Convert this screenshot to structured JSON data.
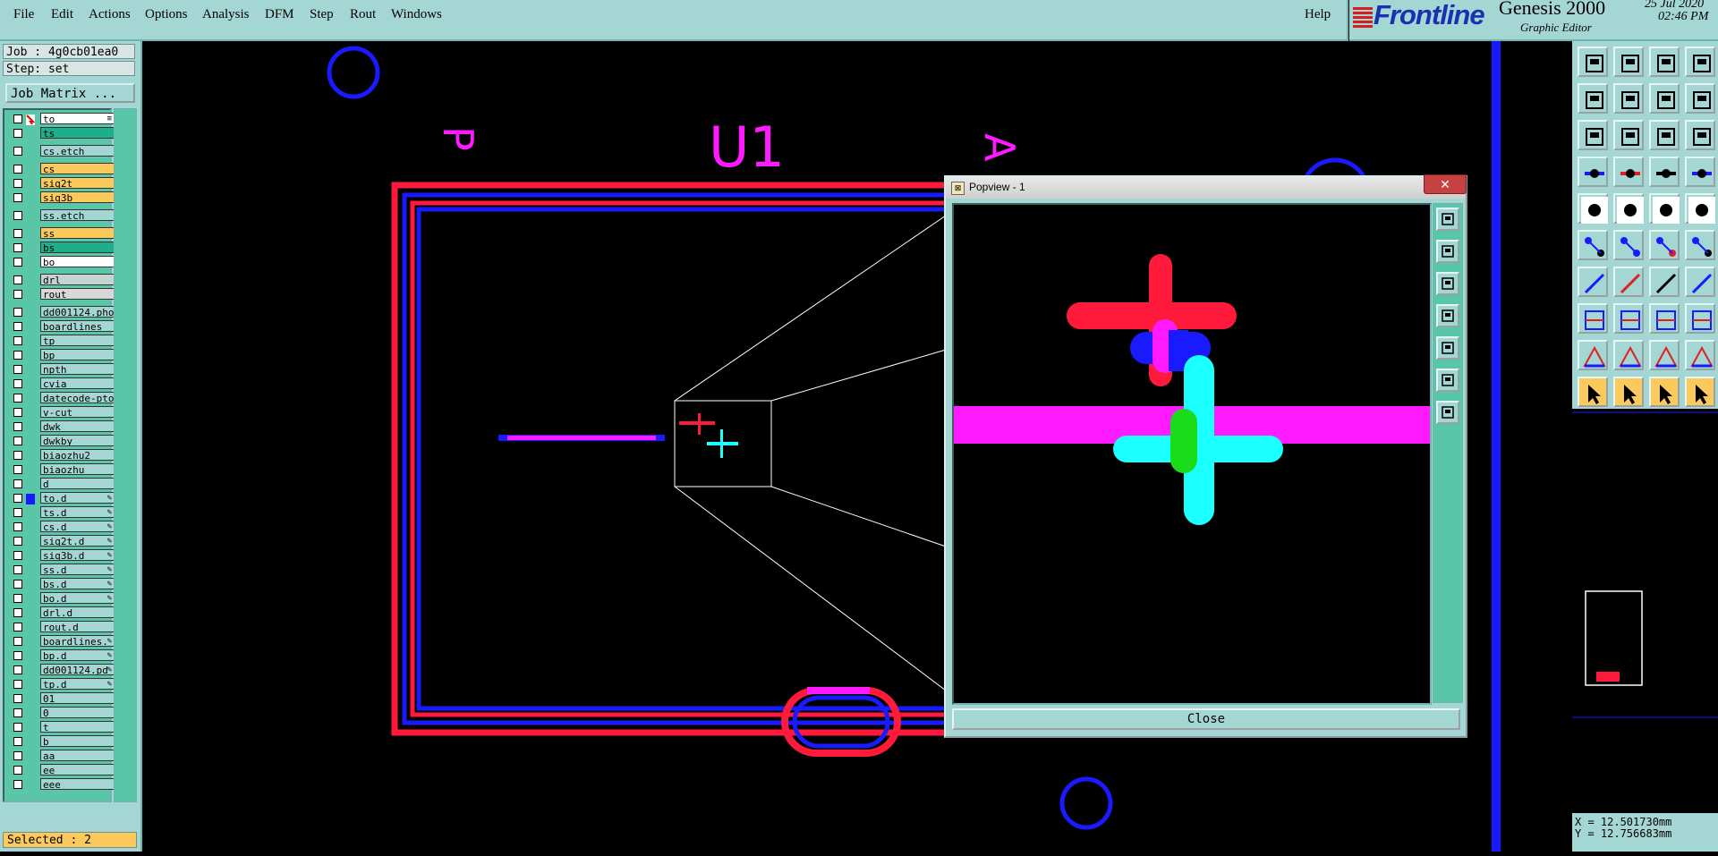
{
  "menu": {
    "file": "File",
    "edit": "Edit",
    "actions": "Actions",
    "options": "Options",
    "analysis": "Analysis",
    "dfm": "DFM",
    "step": "Step",
    "rout": "Rout",
    "windows": "Windows",
    "help": "Help"
  },
  "brand": {
    "logo": "Frontline",
    "app_name": "Genesis 2000",
    "app_sub": "Graphic Editor",
    "date": "25 Jul 2020",
    "time": "02:46 PM"
  },
  "job": {
    "job_label": "Job : 4g0cb01ea0",
    "step_label": "Step: set",
    "matrix_button": "Job Matrix ...",
    "selected": "Selected : 2"
  },
  "layers": [
    {
      "name": "to",
      "color": "white",
      "mark": "≡",
      "indicator": "cursor"
    },
    {
      "name": "ts",
      "color": "green"
    },
    {
      "name": "cs.etch",
      "color": ""
    },
    {
      "name": "cs",
      "color": "yellow"
    },
    {
      "name": "sig2t",
      "color": "yellow"
    },
    {
      "name": "sig3b",
      "color": "yellow"
    },
    {
      "name": "ss.etch",
      "color": ""
    },
    {
      "name": "ss",
      "color": "yellow"
    },
    {
      "name": "bs",
      "color": "green"
    },
    {
      "name": "bo",
      "color": "white"
    },
    {
      "name": "drl",
      "color": "grey2"
    },
    {
      "name": "rout",
      "color": "grey"
    },
    {
      "name": "dd001124.pho",
      "color": ""
    },
    {
      "name": "boardlines",
      "color": ""
    },
    {
      "name": "tp",
      "color": ""
    },
    {
      "name": "bp",
      "color": ""
    },
    {
      "name": "npth",
      "color": ""
    },
    {
      "name": "cvia",
      "color": ""
    },
    {
      "name": "datecode-pto",
      "color": ""
    },
    {
      "name": "v-cut",
      "color": ""
    },
    {
      "name": "dwk",
      "color": ""
    },
    {
      "name": "dwkby",
      "color": ""
    },
    {
      "name": "biaozhu2",
      "color": ""
    },
    {
      "name": "biaozhu",
      "color": ""
    },
    {
      "name": "d",
      "color": ""
    },
    {
      "name": "to.d",
      "color": "",
      "mark": "✎",
      "active": true
    },
    {
      "name": "ts.d",
      "color": "",
      "mark": "✎"
    },
    {
      "name": "cs.d",
      "color": "",
      "mark": "✎"
    },
    {
      "name": "sig2t.d",
      "color": "",
      "mark": "✎"
    },
    {
      "name": "sig3b.d",
      "color": "",
      "mark": "✎"
    },
    {
      "name": "ss.d",
      "color": "",
      "mark": "✎"
    },
    {
      "name": "bs.d",
      "color": "",
      "mark": "✎"
    },
    {
      "name": "bo.d",
      "color": "",
      "mark": "✎"
    },
    {
      "name": "drl.d",
      "color": ""
    },
    {
      "name": "rout.d",
      "color": ""
    },
    {
      "name": "boardlines.",
      "color": "",
      "mark": "✎"
    },
    {
      "name": "bp.d",
      "color": "",
      "mark": "✎"
    },
    {
      "name": "dd001124.pd",
      "color": "",
      "mark": "✎"
    },
    {
      "name": "tp.d",
      "color": "",
      "mark": "✎"
    },
    {
      "name": "01",
      "color": ""
    },
    {
      "name": "0",
      "color": ""
    },
    {
      "name": "t",
      "color": ""
    },
    {
      "name": "b",
      "color": ""
    },
    {
      "name": "aa",
      "color": ""
    },
    {
      "name": "ee",
      "color": ""
    },
    {
      "name": "eee",
      "color": ""
    }
  ],
  "canvas": {
    "label_p": "P",
    "label_u1": "U1",
    "label_a": "A"
  },
  "popview": {
    "title": "Popview - 1",
    "close_x": "✕",
    "close_button": "Close"
  },
  "coords": {
    "x": "X = 12.501730mm",
    "y": "Y = 12.756683mm"
  },
  "colors": {
    "panel": "#a4d6d4",
    "red": "#ff1a3c",
    "blue": "#1a1aff",
    "magenta": "#ff1aff",
    "cyan": "#1affff",
    "green": "#1adc1a"
  }
}
